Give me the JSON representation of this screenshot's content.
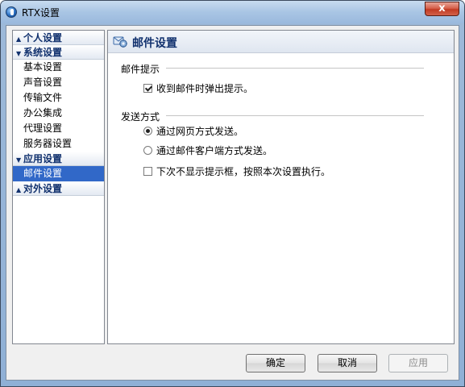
{
  "window": {
    "title": "RTX设置",
    "close_label": "x"
  },
  "nav": {
    "groups": [
      {
        "label": "个人设置",
        "arrow": "▲",
        "items": []
      },
      {
        "label": "系统设置",
        "arrow": "▼",
        "items": [
          "基本设置",
          "声音设置",
          "传输文件",
          "办公集成",
          "代理设置",
          "服务器设置"
        ]
      },
      {
        "label": "应用设置",
        "arrow": "▼",
        "items": [
          "邮件设置"
        ]
      },
      {
        "label": "对外设置",
        "arrow": "▲",
        "items": []
      }
    ],
    "selected": "邮件设置"
  },
  "page": {
    "title": "邮件设置",
    "mail_prompt": {
      "label": "邮件提示",
      "popup_option": {
        "label": "收到邮件时弹出提示。",
        "checked": true
      }
    },
    "send_method": {
      "label": "发送方式",
      "web_option": {
        "label": "通过网页方式发送。",
        "checked": true
      },
      "client_option": {
        "label": "通过邮件客户端方式发送。",
        "checked": false
      },
      "no_prompt_option": {
        "label": "下次不显示提示框，按照本次设置执行。",
        "checked": false
      }
    }
  },
  "buttons": {
    "ok": "确定",
    "cancel": "取消",
    "apply": "应用"
  },
  "colors": {
    "selected_bg": "#3168c8",
    "group_text": "#11316e",
    "close_button": "#c13a22"
  }
}
